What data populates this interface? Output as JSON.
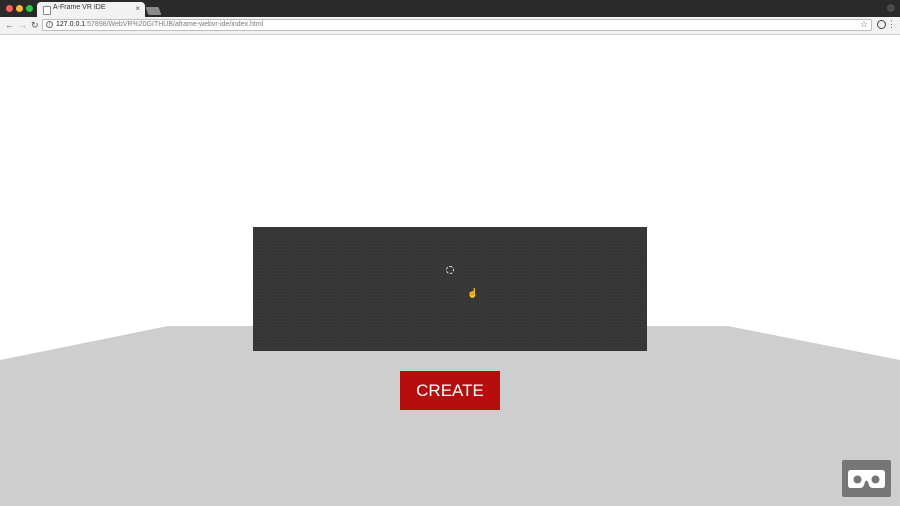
{
  "window": {
    "traffic_colors": {
      "close": "#fe5f57",
      "minimize": "#febc2e",
      "zoom": "#28c840"
    }
  },
  "tab": {
    "title": "A-Frame VR IDE",
    "close_glyph": "×"
  },
  "toolbar": {
    "back_glyph": "←",
    "forward_glyph": "→",
    "reload_glyph": "↻",
    "info_glyph": "i",
    "url_host": "127.0.0.1",
    "url_path": ":57898/WebVR%20GITHUB/aframe-webvr-ide/index.html",
    "star_glyph": "☆",
    "menu_glyph": "⋮"
  },
  "scene": {
    "floor_color": "#cecece",
    "panel_color": "#363636",
    "create_label": "CREATE",
    "create_color": "#b80d0d",
    "vr_button_color": "#767676",
    "hand_glyph": "☝"
  },
  "icons": [
    "page-icon",
    "close-icon",
    "back-arrow-icon",
    "forward-arrow-icon",
    "reload-icon",
    "info-icon",
    "star-icon",
    "extension-icon",
    "menu-icon",
    "profile-icon",
    "cursor-ring-icon",
    "hand-pointer-icon",
    "vr-headset-icon"
  ]
}
